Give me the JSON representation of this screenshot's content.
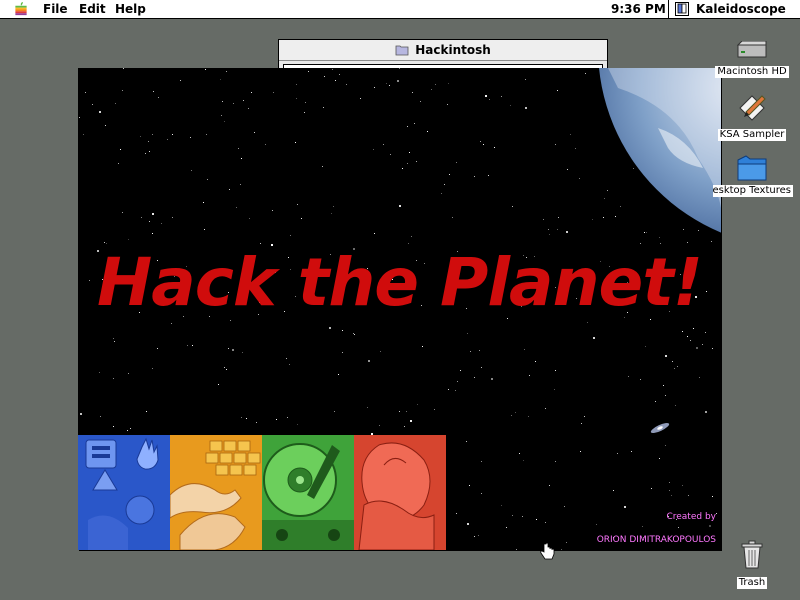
{
  "menubar": {
    "menus": [
      "File",
      "Edit",
      "Help"
    ],
    "clock": "9:36 PM",
    "active_app": "Kaleidoscope"
  },
  "finder_window": {
    "title": "Hackintosh",
    "icon": "folder-icon"
  },
  "splash": {
    "headline": "Hack the Planet!",
    "credit_label": "Created by",
    "credit_name": "ORION DIMITRAKOPOULOS",
    "tiles": [
      "hand-icons-tile",
      "keyboard-hands-tile",
      "hard-drive-tile",
      "mouse-hand-tile"
    ],
    "colors": {
      "headline": "#d00c0c",
      "credit": "#ff77ff",
      "tile_blue": "#2a57c9",
      "tile_orange": "#e89a1e",
      "tile_green": "#3fa33a",
      "tile_red": "#d6452f"
    }
  },
  "desktop": {
    "icons": [
      {
        "name": "hard-drive-icon",
        "label": "Macintosh HD"
      },
      {
        "name": "pencil-document-icon",
        "label": "KSA Sampler"
      },
      {
        "name": "folder-icon",
        "label": "Desktop Textures"
      },
      {
        "name": "trash-icon",
        "label": "Trash"
      }
    ],
    "background": "#666b66"
  }
}
